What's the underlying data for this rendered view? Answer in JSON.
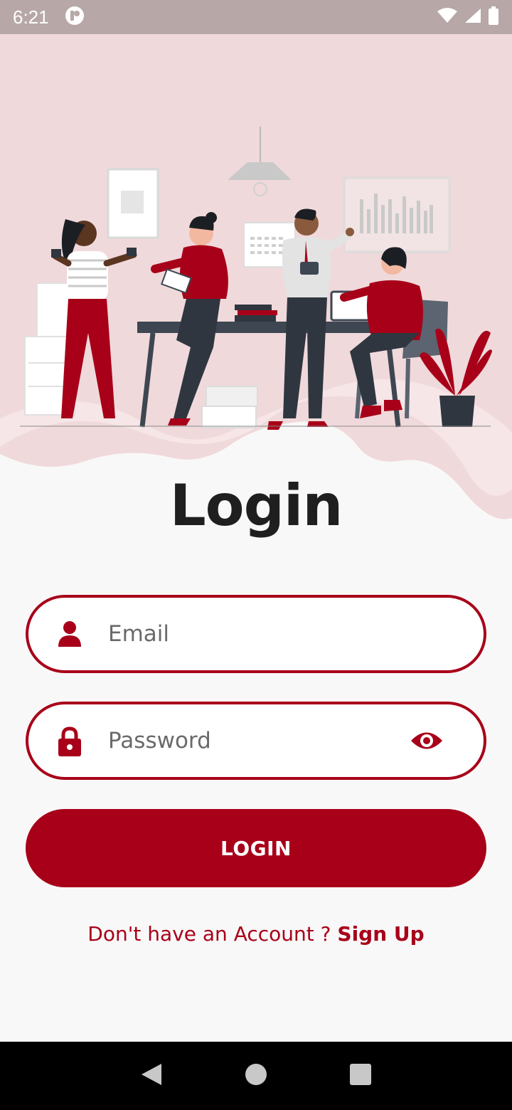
{
  "status_bar": {
    "time": "6:21",
    "icons": [
      "app-notification-icon",
      "wifi-icon",
      "cellular-signal-icon",
      "battery-icon"
    ]
  },
  "hero": {
    "illustration": "office-team-illustration"
  },
  "login": {
    "title": "Login",
    "email_placeholder": "Email",
    "password_placeholder": "Password",
    "button_label": "LOGIN",
    "signup_prompt": "Don't have an Account ? ",
    "signup_link": "Sign Up"
  },
  "nav_bar": {
    "icons": [
      "back-icon",
      "home-icon",
      "recents-icon"
    ]
  },
  "colors": {
    "accent": "#a80019",
    "background": "#f9f8f8",
    "hero_background": "#f0d9db",
    "status_bar": "#b7a7a7",
    "title": "#1f1f1f"
  }
}
